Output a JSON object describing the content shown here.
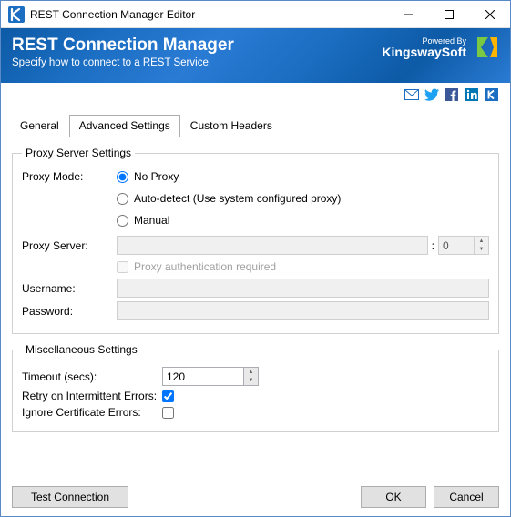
{
  "window": {
    "title": "REST Connection Manager Editor"
  },
  "header": {
    "title": "REST Connection Manager",
    "subtitle": "Specify how to connect to a REST Service.",
    "powered_by": "Powered By",
    "brand": "KingswaySoft"
  },
  "tabs": {
    "general": "General",
    "advanced": "Advanced Settings",
    "custom_headers": "Custom Headers"
  },
  "proxy": {
    "legend": "Proxy Server Settings",
    "mode_label": "Proxy Mode:",
    "no_proxy": "No Proxy",
    "auto_detect": "Auto-detect (Use system configured proxy)",
    "manual": "Manual",
    "server_label": "Proxy Server:",
    "server_value": "",
    "port_value": "0",
    "colon": ":",
    "auth_required": "Proxy authentication required",
    "username_label": "Username:",
    "username_value": "",
    "password_label": "Password:",
    "password_value": ""
  },
  "misc": {
    "legend": "Miscellaneous Settings",
    "timeout_label": "Timeout (secs):",
    "timeout_value": "120",
    "retry_label": "Retry on Intermittent Errors:",
    "ignore_cert_label": "Ignore Certificate Errors:"
  },
  "buttons": {
    "test": "Test Connection",
    "ok": "OK",
    "cancel": "Cancel"
  }
}
